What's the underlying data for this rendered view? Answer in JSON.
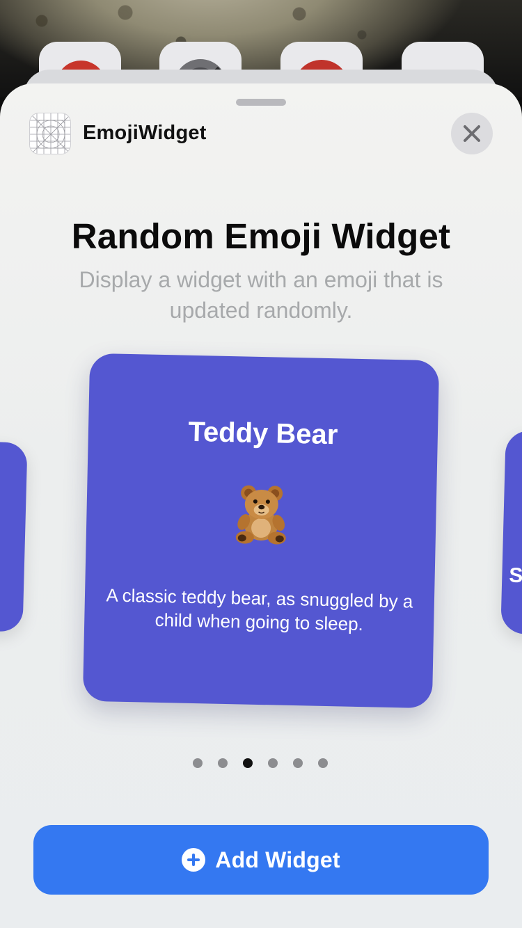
{
  "header": {
    "app_name": "EmojiWidget",
    "app_icon": "blueprint-grid-icon",
    "close_icon": "close-icon"
  },
  "widget_gallery": {
    "title": "Random Emoji Widget",
    "description": "Display a widget with an emoji that is updated randomly.",
    "current_widget": {
      "name": "Teddy Bear",
      "emoji_icon": "teddy-bear-icon",
      "description": "A classic teddy bear, as snuggled by a child when going to sleep."
    },
    "next_widget_peek_letter": "S",
    "page_count": 6,
    "active_page": 3
  },
  "add_button": {
    "label": "Add Widget",
    "icon": "plus-circle-icon"
  },
  "colors": {
    "widget_bg": "#5457d1",
    "accent": "#3478f1",
    "sheet_bg": "#eef0f0"
  }
}
